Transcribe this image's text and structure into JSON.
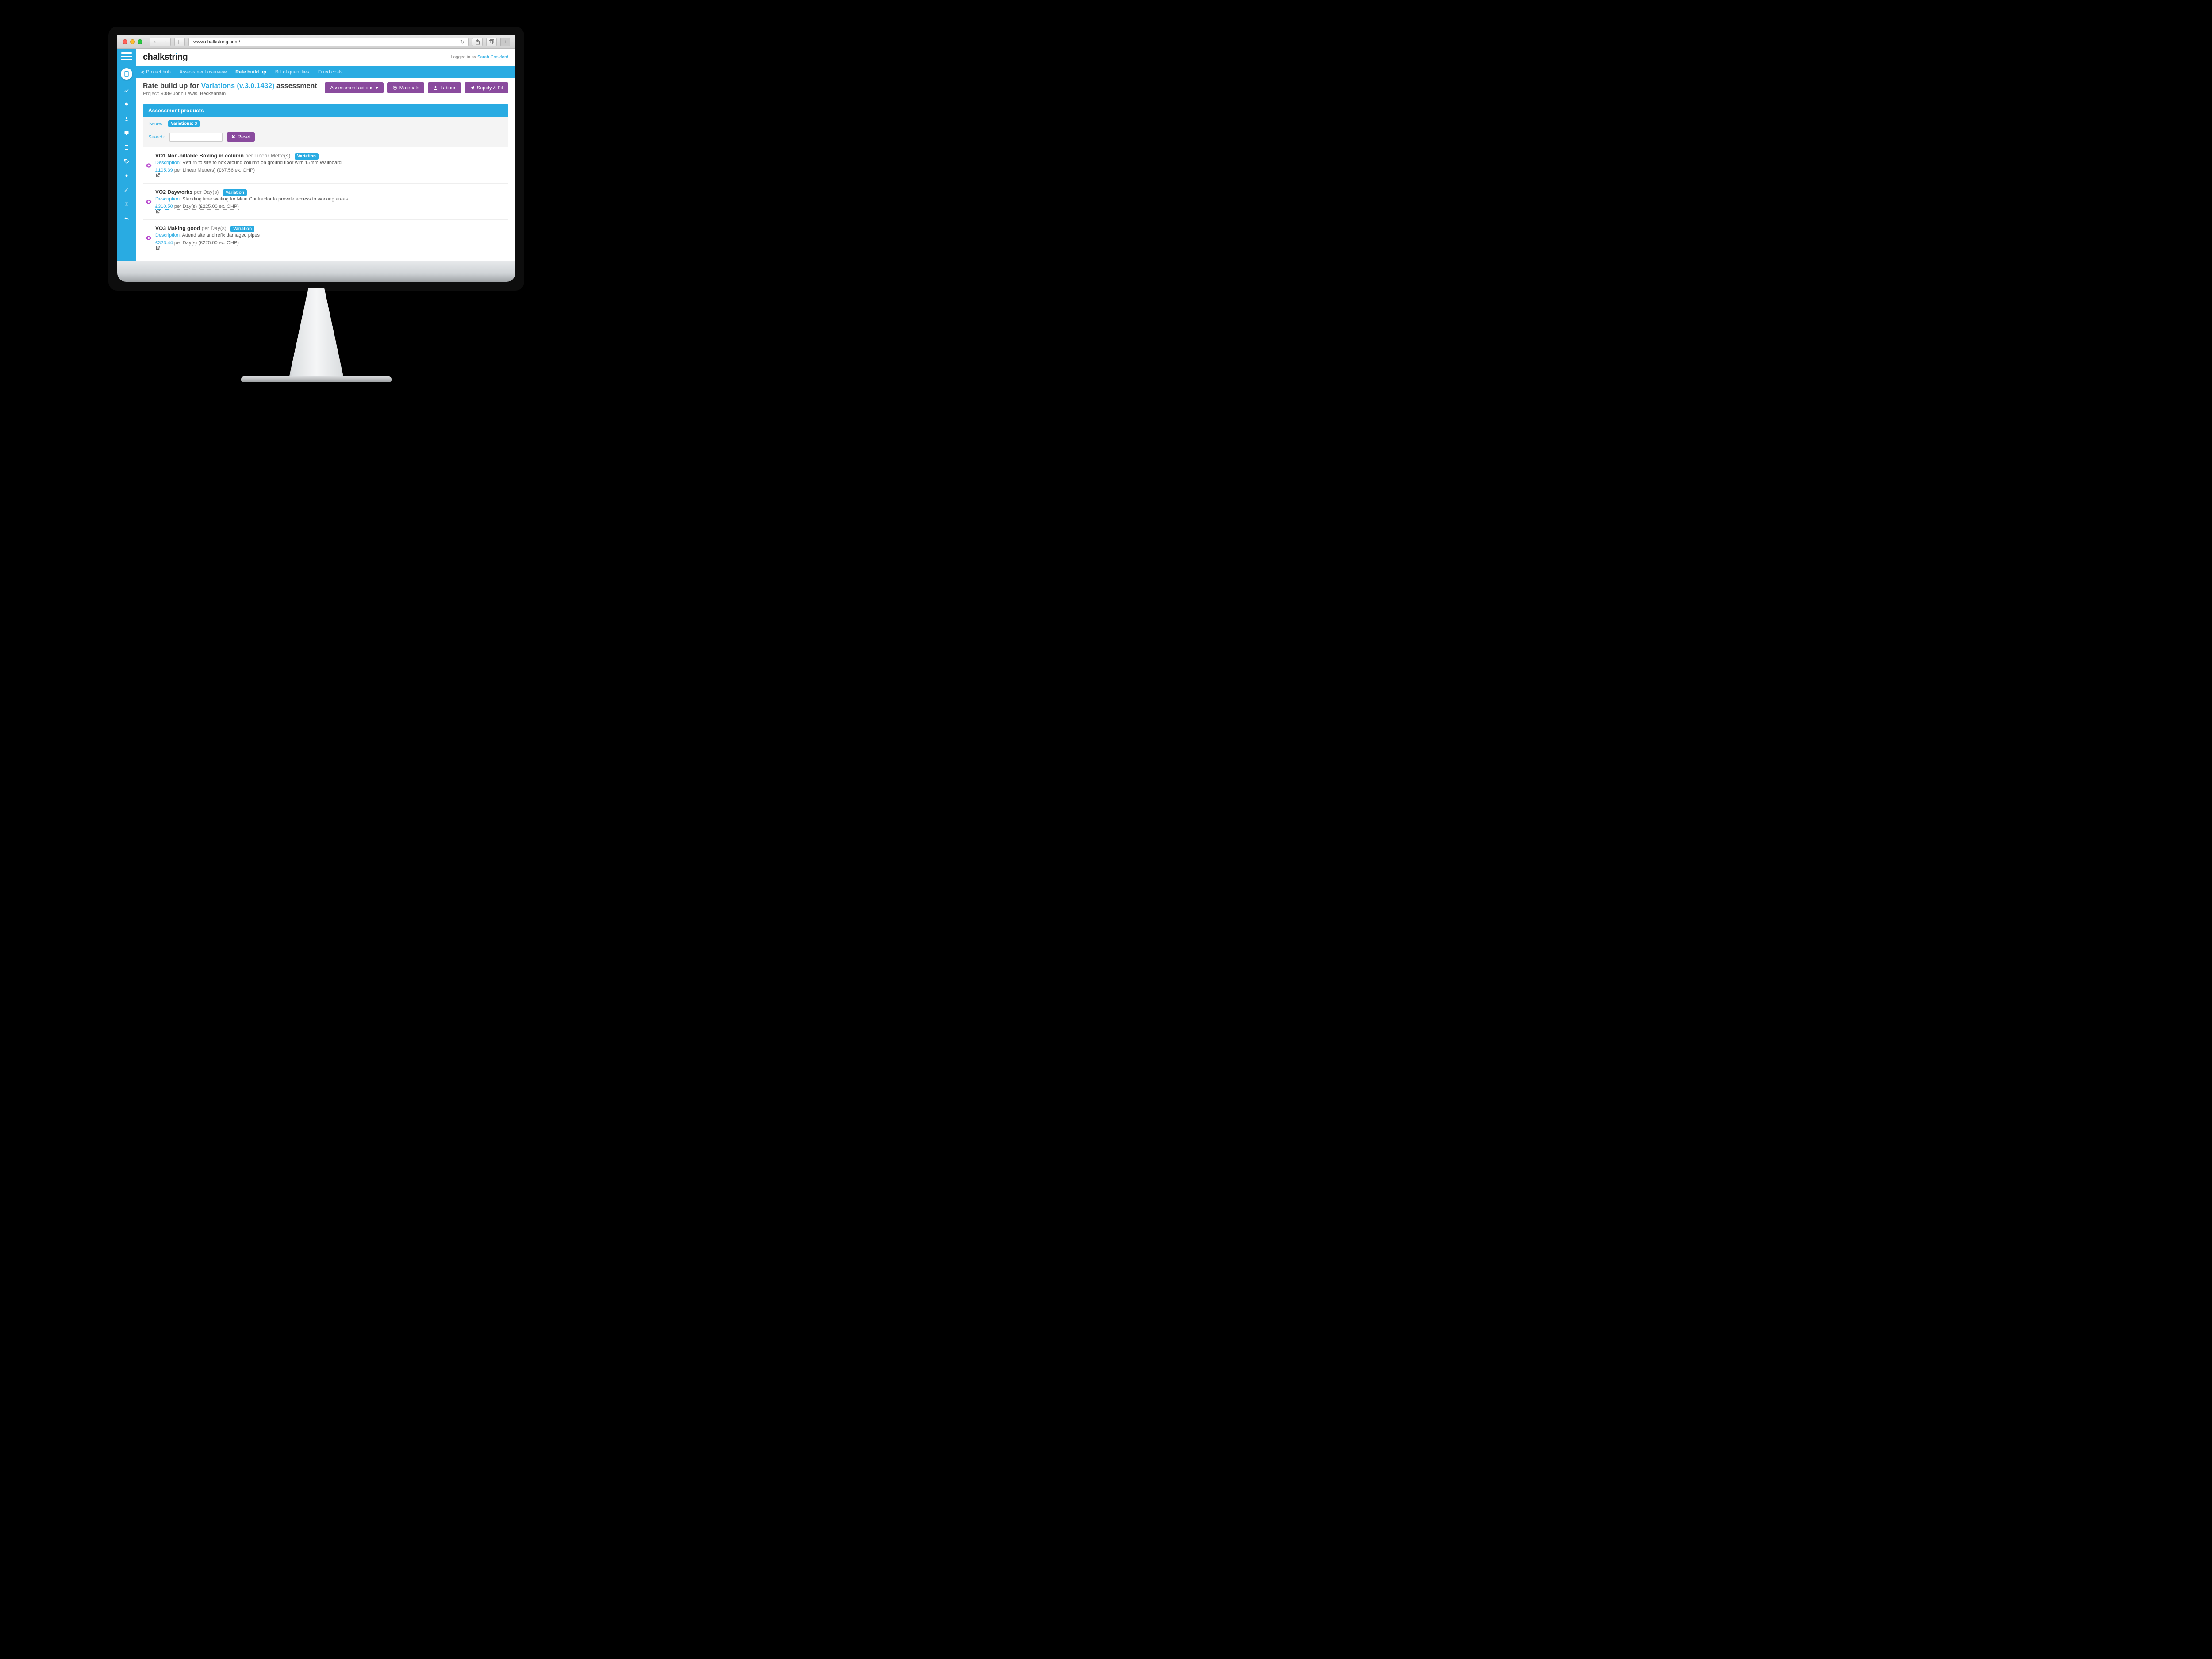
{
  "browser": {
    "url": "www.chalkstring.com/"
  },
  "brand": "chalkstring",
  "login": {
    "prefix": "Logged in as ",
    "user": "Sarah Crawford"
  },
  "nav": {
    "project_hub": "Project hub",
    "assessment_overview": "Assessment overview",
    "rate_build_up": "Rate build up",
    "bill_of_quantities": "Bill of quantities",
    "fixed_costs": "Fixed costs"
  },
  "header": {
    "prefix": "Rate build up for ",
    "variation": "Variations (v.3.0.1432)",
    "suffix": " assessment",
    "project_label": "Project:",
    "project_name": "9089 John Lewis, Beckenham",
    "buttons": {
      "assessment_actions": "Assessment actions",
      "materials": "Materials",
      "labour": "Labour",
      "supply_fit": "Supply & Fit"
    }
  },
  "panel": {
    "title": "Assessment products",
    "issues_label": "Issues:",
    "issues_pill": "Variations: 3",
    "search_label": "Search:",
    "reset": "Reset"
  },
  "products": [
    {
      "title_bold": "VO1 Non-billable Boxing in column",
      "per": " per Linear Metre(s)",
      "tag": "Variation",
      "desc_label": "Description:",
      "desc": " Return to site to box around column on ground floor with 15mm Wallboard",
      "price": "£105.39",
      "price_rest": " per Linear Metre(s) (£67.56 ex. OHP)"
    },
    {
      "title_bold": "VO2 Dayworks",
      "per": " per Day(s)",
      "tag": "Variation",
      "desc_label": "Description:",
      "desc": " Standing time waiting for Main Contractor to provide access to working areas",
      "price": "£310.50",
      "price_rest": " per Day(s) (£225.00 ex. OHP)"
    },
    {
      "title_bold": "VO3 Making good",
      "per": " per Day(s)",
      "tag": "Variation",
      "desc_label": "Description:",
      "desc": " Attend site and refix damaged pipes",
      "price": "£323.44",
      "price_rest": " per Day(s) (£225.00 ex. OHP)"
    }
  ]
}
